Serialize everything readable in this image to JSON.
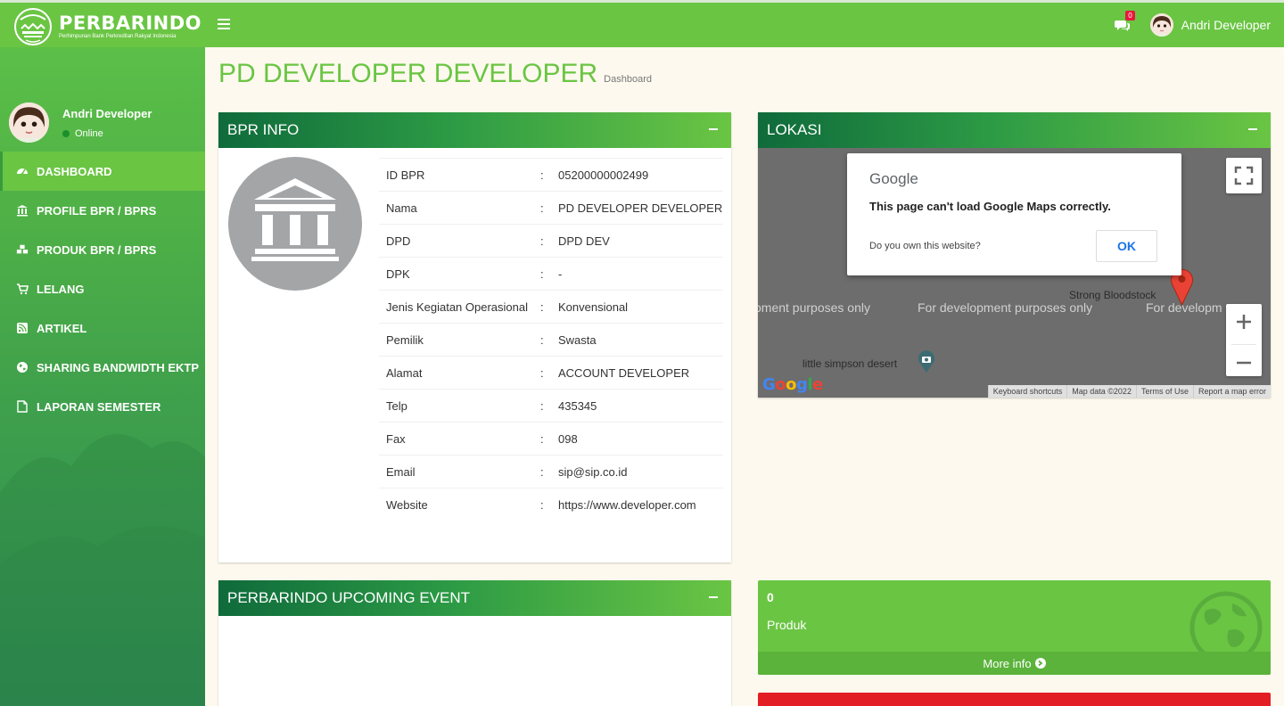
{
  "brand": {
    "name": "PERBARINDO",
    "tagline": "Perhimpunan Bank Perkreditan Rakyat Indonesia",
    "primary_color": "#6ac543",
    "dark_color": "#0f6b3b"
  },
  "topbar": {
    "menu_icon": "hamburger-icon",
    "chat_icon": "comments-icon",
    "notification_count": "0",
    "user_name": "Andri Developer"
  },
  "sidebar": {
    "user_name": "Andri Developer",
    "status": "Online",
    "items": [
      {
        "label": "DASHBOARD",
        "icon": "dashboard-icon",
        "active": true
      },
      {
        "label": "PROFILE BPR / BPRS",
        "icon": "bank-icon",
        "active": false
      },
      {
        "label": "PRODUK BPR / BPRS",
        "icon": "cubes-icon",
        "active": false
      },
      {
        "label": "LELANG",
        "icon": "cart-icon",
        "active": false
      },
      {
        "label": "ARTIKEL",
        "icon": "rss-icon",
        "active": false
      },
      {
        "label": "SHARING BANDWIDTH EKTP",
        "icon": "globe-icon",
        "active": false
      },
      {
        "label": "LAPORAN SEMESTER",
        "icon": "file-icon",
        "active": false
      }
    ]
  },
  "page": {
    "title": "PD DEVELOPER DEVELOPER",
    "subtitle": "Dashboard"
  },
  "bpr_info": {
    "title": "BPR INFO",
    "rows": [
      {
        "key": "ID BPR",
        "sep": ":",
        "value": "05200000002499"
      },
      {
        "key": "Nama",
        "sep": ":",
        "value": "PD DEVELOPER DEVELOPER"
      },
      {
        "key": "DPD",
        "sep": ":",
        "value": "DPD DEV"
      },
      {
        "key": "DPK",
        "sep": ":",
        "value": "-"
      },
      {
        "key": "Jenis Kegiatan Operasional",
        "sep": ":",
        "value": "Konvensional"
      },
      {
        "key": "Pemilik",
        "sep": ":",
        "value": "Swasta"
      },
      {
        "key": "Alamat",
        "sep": ":",
        "value": "ACCOUNT DEVELOPER"
      },
      {
        "key": "Telp",
        "sep": ":",
        "value": "435345"
      },
      {
        "key": "Fax",
        "sep": ":",
        "value": "098"
      },
      {
        "key": "Email",
        "sep": ":",
        "value": "sip@sip.co.id"
      },
      {
        "key": "Website",
        "sep": ":",
        "value": "https://www.developer.com"
      }
    ]
  },
  "lokasi": {
    "title": "LOKASI",
    "dialog_brand": "Google",
    "dialog_message": "This page can't load Google Maps correctly.",
    "dialog_question": "Do you own this website?",
    "dialog_ok": "OK",
    "watermark_1": "oment purposes only",
    "watermark_2": "For development purposes only",
    "watermark_3": "For developm",
    "place_1": "Strong Bloodstock",
    "place_2": "little simpson desert",
    "footer_shortcuts": "Keyboard shortcuts",
    "footer_mapdata": "Map data ©2022",
    "footer_terms": "Terms of Use",
    "footer_report": "Report a map error",
    "logo": "Google"
  },
  "upcoming_event": {
    "title": "PERBARINDO UPCOMING EVENT"
  },
  "produk_stat": {
    "count": "0",
    "label": "Produk",
    "more_info": "More info"
  }
}
